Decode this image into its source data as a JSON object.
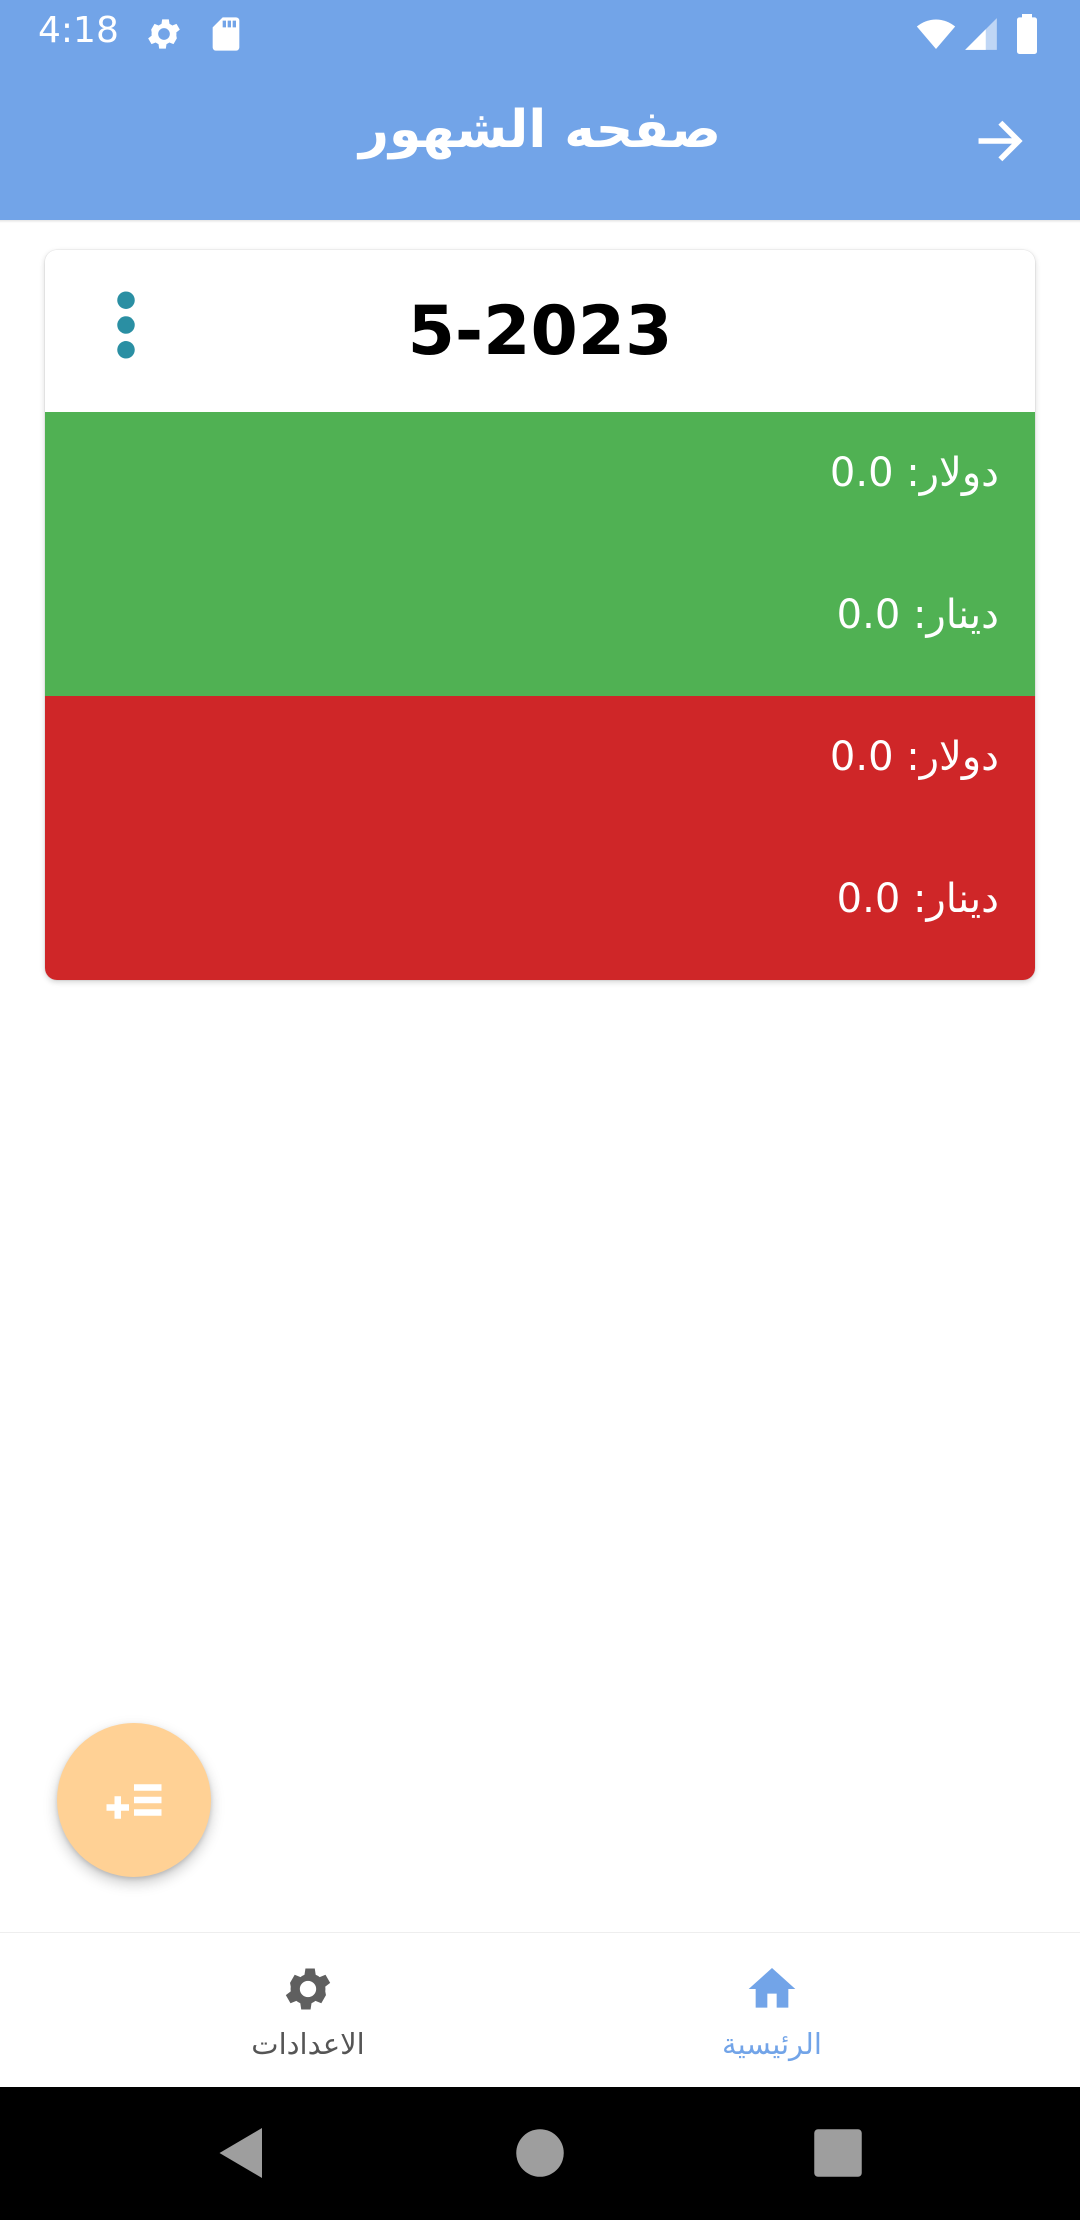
{
  "status": {
    "time": "4:18"
  },
  "appbar": {
    "title": "صفحه الشهور"
  },
  "card": {
    "title": "5-2023",
    "income": {
      "dollar": "دولار: 0.0",
      "dinar": "دينار: 0.0"
    },
    "expense": {
      "dollar": "دولار: 0.0",
      "dinar": "دينار: 0.0"
    }
  },
  "bottom_nav": {
    "settings_label": "الاعدادات",
    "home_label": "الرئيسية"
  },
  "colors": {
    "primary": "#72A4E8",
    "income_green": "#50B153",
    "expense_red": "#CF2628",
    "fab": "#FFD195",
    "menu_dots": "#2A8FA3"
  },
  "icons": {
    "status": [
      "gear-icon",
      "sd-card-icon",
      "wifi-icon",
      "signal-icon",
      "battery-icon"
    ],
    "appbar": "arrow-right-icon",
    "fab": "add-list-icon",
    "nav": [
      "gear-icon",
      "home-icon"
    ],
    "system": [
      "back-icon",
      "home-circle-icon",
      "recents-icon"
    ]
  }
}
